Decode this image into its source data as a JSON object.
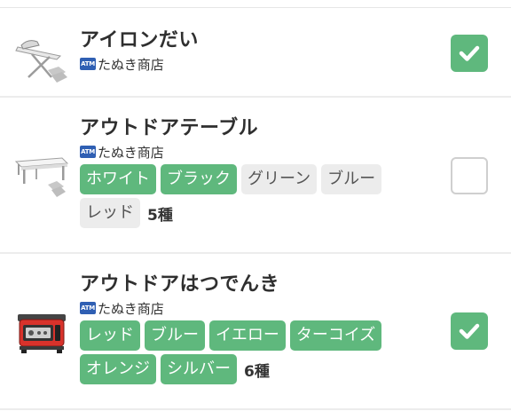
{
  "items": [
    {
      "name": "アイロンだい",
      "shop_icon": "ATM",
      "shop": "たぬき商店",
      "checked": true,
      "icon": "ironing-board-icon",
      "tags": [],
      "count": ""
    },
    {
      "name": "アウトドアテーブル",
      "shop_icon": "ATM",
      "shop": "たぬき商店",
      "checked": false,
      "icon": "outdoor-table-icon",
      "tags": [
        {
          "label": "ホワイト",
          "active": true
        },
        {
          "label": "ブラック",
          "active": true
        },
        {
          "label": "グリーン",
          "active": false
        },
        {
          "label": "ブルー",
          "active": false
        },
        {
          "label": "レッド",
          "active": false
        }
      ],
      "count": "5種"
    },
    {
      "name": "アウトドアはつでんき",
      "shop_icon": "ATM",
      "shop": "たぬき商店",
      "checked": true,
      "icon": "generator-icon",
      "tags": [
        {
          "label": "レッド",
          "active": true
        },
        {
          "label": "ブルー",
          "active": true
        },
        {
          "label": "イエロー",
          "active": true
        },
        {
          "label": "ターコイズ",
          "active": true
        },
        {
          "label": "オレンジ",
          "active": true
        },
        {
          "label": "シルバー",
          "active": true
        }
      ],
      "count": "6種"
    }
  ],
  "colors": {
    "active_tag": "#5fb87d",
    "inactive_tag": "#ececec",
    "check_on": "#5fb87d"
  }
}
